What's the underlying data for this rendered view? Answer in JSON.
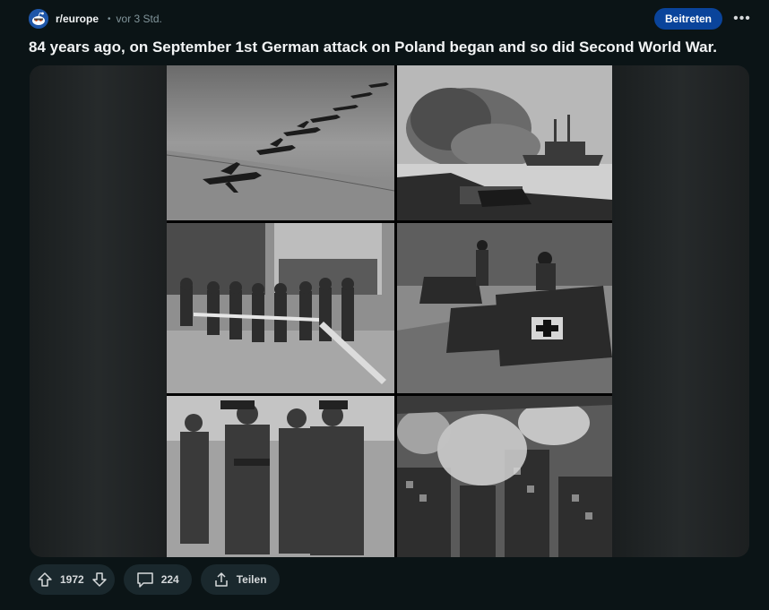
{
  "header": {
    "subreddit": "r/europe",
    "separator": "•",
    "time": "vor 3 Std.",
    "join_label": "Beitreten",
    "more_label": "•••"
  },
  "post": {
    "title": "84 years ago, on September 1st German attack on Poland began and so did Second World War."
  },
  "gallery": {
    "images": [
      {
        "name": "dive-bombers-image",
        "description": "aircraft formation"
      },
      {
        "name": "battleship-shelling-image",
        "description": "battleship firing"
      },
      {
        "name": "border-barrier-image",
        "description": "soldiers at barrier"
      },
      {
        "name": "tanks-image",
        "description": "tanks advancing"
      },
      {
        "name": "officers-handshake-image",
        "description": "officers meeting"
      },
      {
        "name": "burning-city-image",
        "description": "city aerial smoke"
      }
    ]
  },
  "actions": {
    "votes": "1972",
    "comments": "224",
    "share_label": "Teilen"
  },
  "colors": {
    "background": "#0b1416",
    "join_button": "#0a449b",
    "action_pill": "#1a282d"
  }
}
